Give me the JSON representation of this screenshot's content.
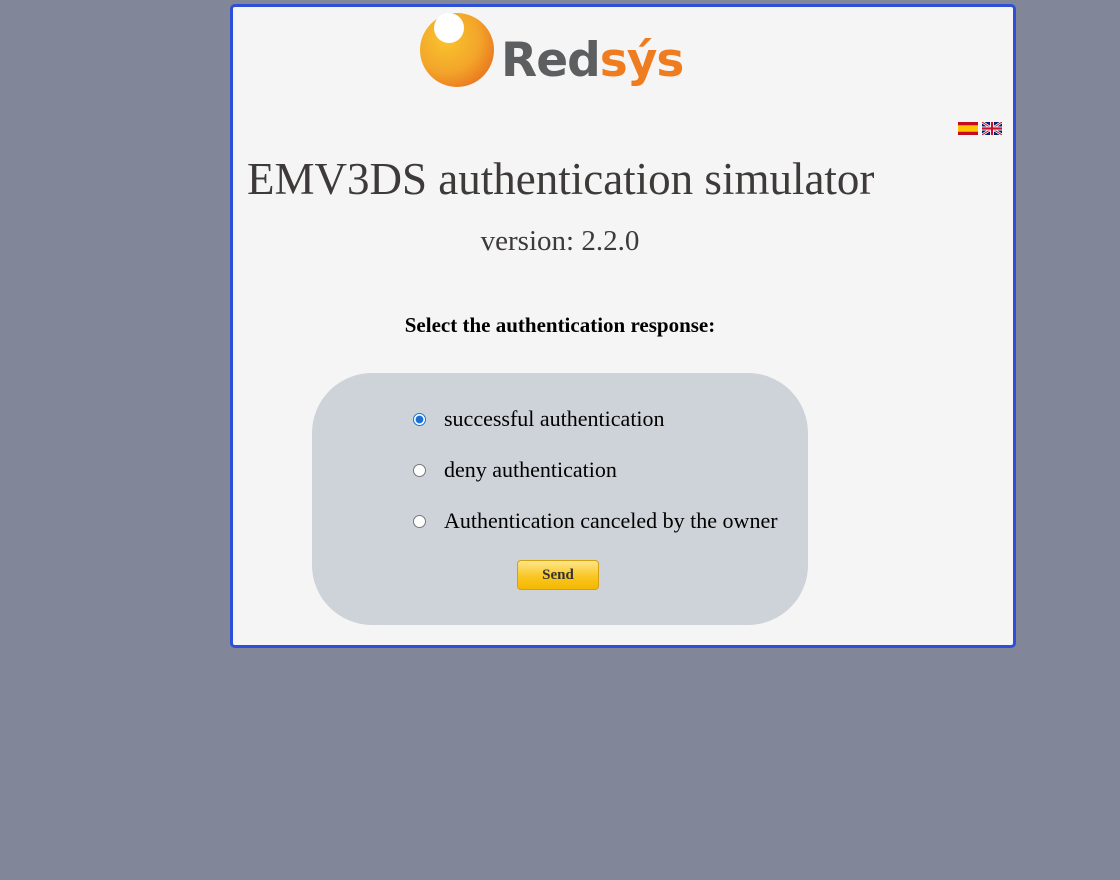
{
  "brand": {
    "name_part1": "Red",
    "name_part2": "sýs",
    "colors": {
      "text_grey": "#5d5e5f",
      "orange": "#ef7d1f",
      "border": "#2e4fd8",
      "background": "#818699"
    }
  },
  "languages": [
    {
      "icon": "spain-flag-icon"
    },
    {
      "icon": "uk-flag-icon"
    }
  ],
  "header": {
    "title": "EMV3DS authentication simulator",
    "version": "version: 2.2.0"
  },
  "form": {
    "prompt": "Select the authentication response:",
    "options": [
      {
        "label": "successful authentication",
        "selected": true
      },
      {
        "label": "deny authentication",
        "selected": false
      },
      {
        "label": "Authentication canceled by the owner",
        "selected": false
      }
    ],
    "send_label": "Send"
  }
}
